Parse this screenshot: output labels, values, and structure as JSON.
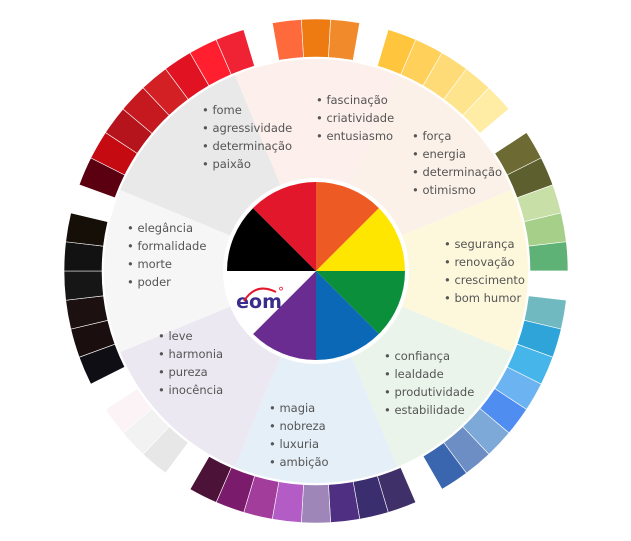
{
  "colors": {
    "outer_ring": [
      "#FF6A3D",
      "#EE7A12",
      "#F08A2A",
      "#FFFFFF",
      "#FFC53D",
      "#FFD05A",
      "#FFDB77",
      "#FFE48E",
      "#FFEDA6",
      "#FFFFFF",
      "#6E6A33",
      "#5E5F2E",
      "#C9DFA8",
      "#A6D08A",
      "#5FB276",
      "#FFFFFF",
      "#71B9C0",
      "#2EA4D9",
      "#46B6EA",
      "#6BB3F1",
      "#4F8EF0",
      "#7DA9D8",
      "#6D8EC4",
      "#3A66B0",
      "#FFFFFF",
      "#40306A",
      "#3A2E6E",
      "#4E2F82",
      "#9E86B8",
      "#B35CC6",
      "#A23D9C",
      "#7A1C6B",
      "#4C1238",
      "#FFFFFF",
      "#E7E7E7",
      "#F2F2F2",
      "#FBF3F6",
      "#FFFFFF",
      "#0E0E14",
      "#1A0E0E",
      "#1C1010",
      "#161616",
      "#121212",
      "#150F08",
      "#FFFFFF",
      "#5A0011",
      "#C50A12",
      "#B5141C",
      "#C5181F",
      "#D22025",
      "#E11322",
      "#FF1F2F",
      "#EF2334",
      "#FFFFFF"
    ],
    "inner_pie": [
      "#EE5A24",
      "#FFE600",
      "#0B8F3A",
      "#0B68B7",
      "#6A2C91",
      "#FFFFFF",
      "#000000",
      "#E3172B"
    ],
    "sectors": [
      "#FDEFEC",
      "#FCF1E8",
      "#FDF8DC",
      "#EAF4EA",
      "#E4EFF8",
      "#ECE8F2",
      "#F6F6F6",
      "#E9E9E9"
    ]
  },
  "logo": {
    "text": "eom",
    "superscript": "°",
    "icon": "eom-logo-icon"
  },
  "groups": [
    {
      "id": "red",
      "items": [
        "fome",
        "agressividade",
        "determinação",
        "paixão"
      ]
    },
    {
      "id": "orange",
      "items": [
        "fascinação",
        "criatividade",
        "entusiasmo"
      ]
    },
    {
      "id": "yellow",
      "items": [
        "força",
        "energia",
        "determinação",
        "otimismo"
      ]
    },
    {
      "id": "green",
      "items": [
        "segurança",
        "renovação",
        "crescimento",
        "bom humor"
      ]
    },
    {
      "id": "blue",
      "items": [
        "confiança",
        "lealdade",
        "produtividade",
        "estabilidade"
      ]
    },
    {
      "id": "purple",
      "items": [
        "magia",
        "nobreza",
        "luxuria",
        "ambição"
      ]
    },
    {
      "id": "white",
      "items": [
        "leve",
        "harmonia",
        "pureza",
        "inocência"
      ]
    },
    {
      "id": "black",
      "items": [
        "elegância",
        "formalidade",
        "morte",
        "poder"
      ]
    }
  ]
}
